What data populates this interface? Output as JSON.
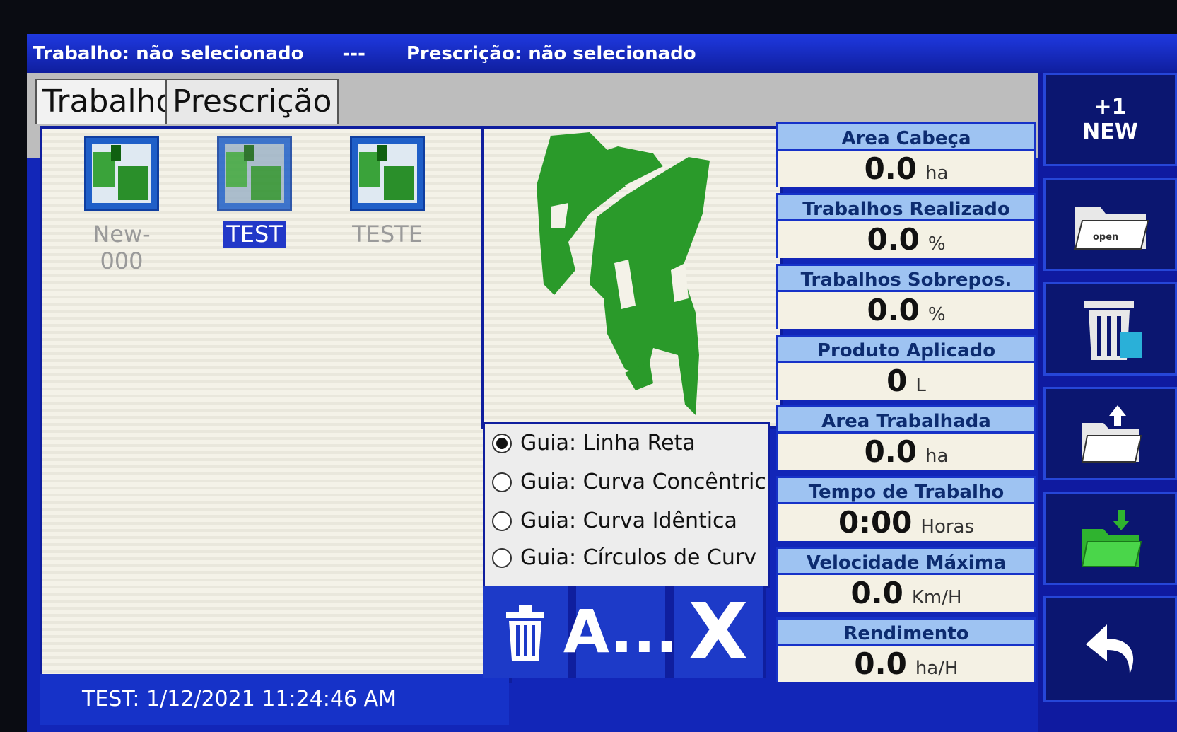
{
  "header": {
    "trabalho": "Trabalho: não selecionado",
    "separator": "---",
    "prescricao": "Prescrição: não selecionado"
  },
  "tabs": [
    {
      "label": "Trabalho",
      "active": true
    },
    {
      "label": "Prescrição",
      "active": false
    }
  ],
  "files": [
    {
      "name": "New-000",
      "selected": false,
      "icon": "field-map-icon"
    },
    {
      "name": "TEST",
      "selected": true,
      "icon": "field-map-icon"
    },
    {
      "name": "TESTE",
      "selected": false,
      "icon": "field-map-icon"
    }
  ],
  "status_text": "TEST: 1/12/2021 11:24:46 AM",
  "guides": [
    {
      "label": "Guia: Linha Reta",
      "checked": true
    },
    {
      "label": "Guia: Curva Concêntric",
      "checked": false
    },
    {
      "label": "Guia: Curva Idêntica",
      "checked": false
    },
    {
      "label": "Guia: Círculos de Curv",
      "checked": false
    }
  ],
  "action_buttons": {
    "delete_icon": "trash-icon",
    "a_label": "A...",
    "x_label": "X"
  },
  "stats": [
    {
      "label": "Area Cabeça",
      "value": "0.0",
      "unit": "ha"
    },
    {
      "label": "Trabalhos Realizado",
      "value": "0.0",
      "unit": "%"
    },
    {
      "label": "Trabalhos Sobrepos.",
      "value": "0.0",
      "unit": "%"
    },
    {
      "label": "Produto Aplicado",
      "value": "0",
      "unit": "L"
    },
    {
      "label": "Area Trabalhada",
      "value": "0.0",
      "unit": "ha"
    },
    {
      "label": "Tempo de Trabalho",
      "value": "0:00",
      "unit": "Horas"
    },
    {
      "label": "Velocidade Máxima",
      "value": "0.0",
      "unit": "Km/H"
    },
    {
      "label": "Rendimento",
      "value": "0.0",
      "unit": "ha/H"
    }
  ],
  "sidebar": {
    "new_top": "+1",
    "new_label": "NEW",
    "open_label": "open",
    "icons": [
      "new-icon",
      "open-folder-icon",
      "delete-icon",
      "folder-upload-icon",
      "folder-download-icon",
      "back-arrow-icon"
    ]
  },
  "colors": {
    "screen_blue": "#1226b8",
    "label_blue": "#9ec3f2",
    "field_green": "#2a9a2a"
  }
}
